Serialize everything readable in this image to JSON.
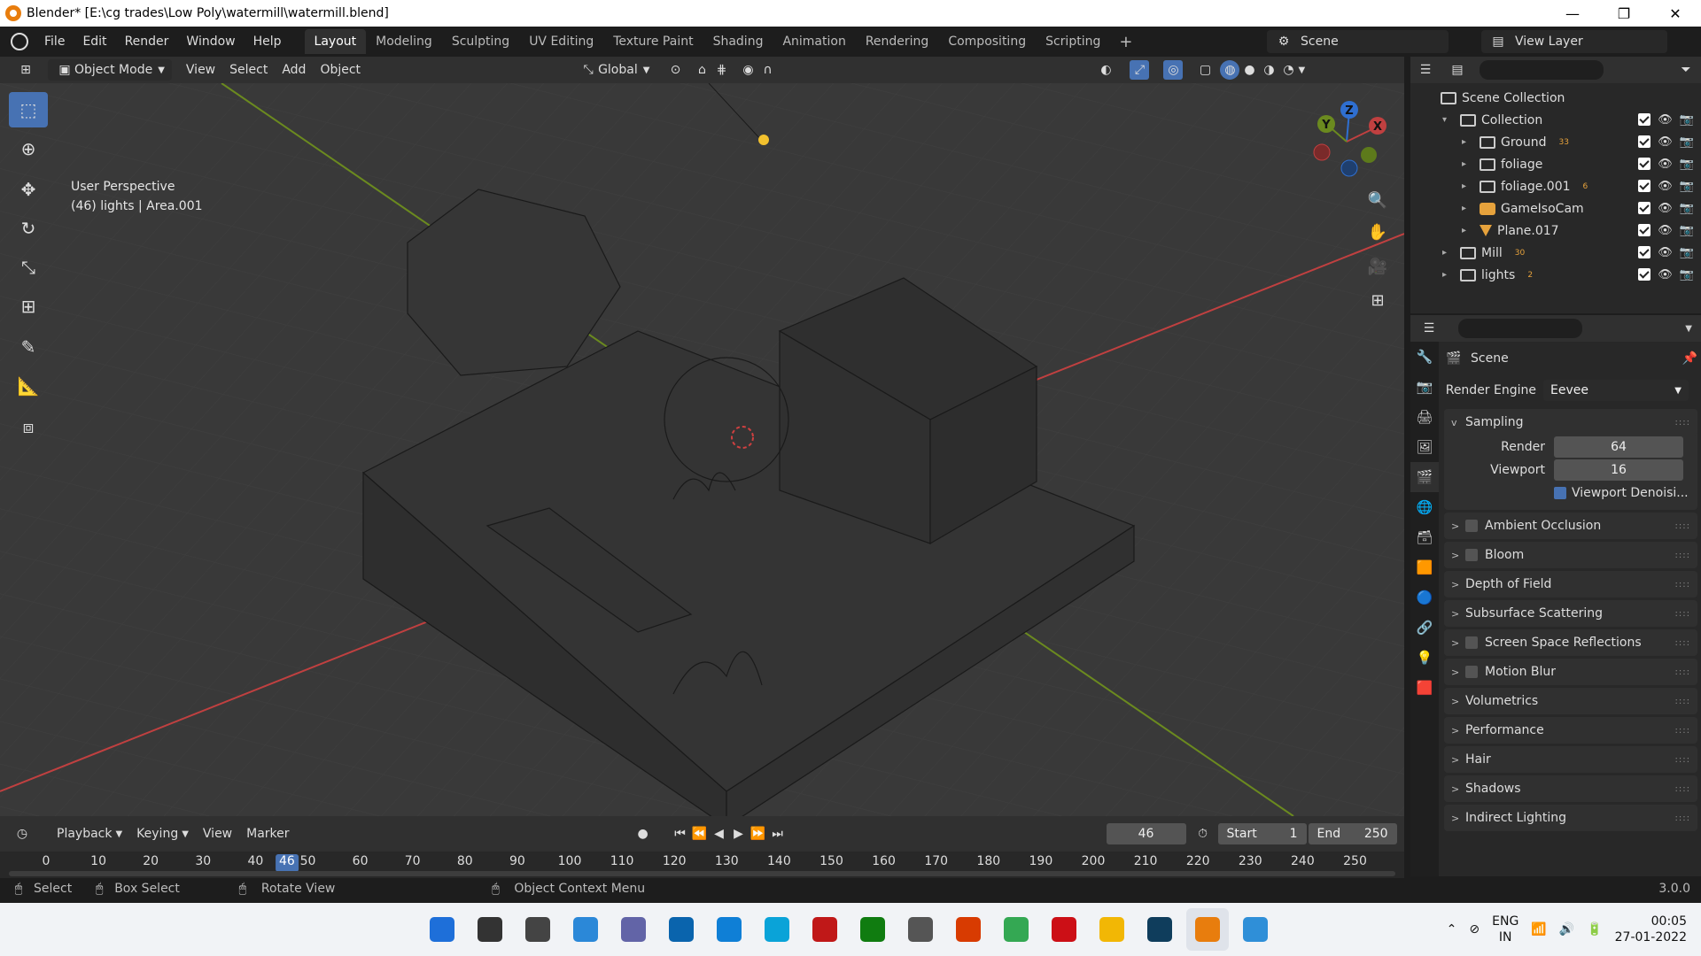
{
  "window": {
    "title": "Blender* [E:\\cg trades\\Low Poly\\watermill\\watermill.blend]",
    "minimize": "—",
    "restore": "❐",
    "close": "✕"
  },
  "menu": {
    "items": [
      "File",
      "Edit",
      "Render",
      "Window",
      "Help"
    ],
    "workspaces": [
      "Layout",
      "Modeling",
      "Sculpting",
      "UV Editing",
      "Texture Paint",
      "Shading",
      "Animation",
      "Rendering",
      "Compositing",
      "Scripting"
    ],
    "active_workspace": "Layout",
    "add_workspace": "+",
    "scene": "Scene",
    "view_layer": "View Layer"
  },
  "viewport_header": {
    "mode": "Object Mode",
    "menus": [
      "View",
      "Select",
      "Add",
      "Object"
    ],
    "transform_orientation": "Global"
  },
  "viewport": {
    "perspective_label": "User Perspective",
    "info_label": "(46) lights | Area.001",
    "axis_labels": {
      "x": "X",
      "y": "Y",
      "z": "Z"
    }
  },
  "tools": [
    "select-box",
    "cursor",
    "move",
    "rotate",
    "scale",
    "transform",
    "annotate",
    "measure",
    "add-cube"
  ],
  "outliner": {
    "root": "Scene Collection",
    "items": [
      {
        "name": "Collection",
        "indent": 1,
        "type": "collection",
        "badge": ""
      },
      {
        "name": "Ground",
        "indent": 2,
        "type": "collection",
        "badge": "33"
      },
      {
        "name": "foliage",
        "indent": 2,
        "type": "collection",
        "badge": ""
      },
      {
        "name": "foliage.001",
        "indent": 2,
        "type": "collection",
        "badge": "6"
      },
      {
        "name": "GameIsoCam",
        "indent": 2,
        "type": "camera",
        "badge": ""
      },
      {
        "name": "Plane.017",
        "indent": 2,
        "type": "mesh",
        "badge": ""
      },
      {
        "name": "Mill",
        "indent": 1,
        "type": "collection",
        "badge": "30"
      },
      {
        "name": "lights",
        "indent": 1,
        "type": "collection",
        "badge": "2"
      }
    ]
  },
  "properties": {
    "context": "Scene",
    "render_engine_label": "Render Engine",
    "render_engine": "Eevee",
    "sampling": {
      "title": "Sampling",
      "render_label": "Render",
      "render": "64",
      "viewport_label": "Viewport",
      "viewport": "16",
      "denoise_label": "Viewport Denoisi..."
    },
    "panels": [
      {
        "label": "Ambient Occlusion",
        "checkbox": true
      },
      {
        "label": "Bloom",
        "checkbox": true
      },
      {
        "label": "Depth of Field",
        "checkbox": false
      },
      {
        "label": "Subsurface Scattering",
        "checkbox": false
      },
      {
        "label": "Screen Space Reflections",
        "checkbox": true
      },
      {
        "label": "Motion Blur",
        "checkbox": true
      },
      {
        "label": "Volumetrics",
        "checkbox": false
      },
      {
        "label": "Performance",
        "checkbox": false
      },
      {
        "label": "Hair",
        "checkbox": false
      },
      {
        "label": "Shadows",
        "checkbox": false
      },
      {
        "label": "Indirect Lighting",
        "checkbox": false
      }
    ]
  },
  "timeline": {
    "menus": [
      "Playback",
      "Keying",
      "View",
      "Marker"
    ],
    "current_frame": "46",
    "start_label": "Start",
    "start": "1",
    "end_label": "End",
    "end": "250",
    "ticks": [
      "0",
      "10",
      "20",
      "30",
      "40",
      "50",
      "60",
      "70",
      "80",
      "90",
      "100",
      "110",
      "120",
      "130",
      "140",
      "150",
      "160",
      "170",
      "180",
      "190",
      "200",
      "210",
      "220",
      "230",
      "240",
      "250"
    ],
    "playhead_label": "46"
  },
  "statusbar": {
    "select": "Select",
    "box_select": "Box Select",
    "rotate_view": "Rotate View",
    "context_menu": "Object Context Menu",
    "version": "3.0.0"
  },
  "taskbar": {
    "apps": [
      "start",
      "search",
      "task-view",
      "widgets",
      "teams",
      "mail",
      "edge",
      "launcher",
      "mcafee",
      "xbox",
      "settings",
      "office",
      "chrome",
      "opera",
      "explorer",
      "photoshop",
      "blender",
      "store"
    ],
    "lang": "ENG",
    "region": "IN",
    "time": "00:05",
    "date": "27-01-2022"
  },
  "colors": {
    "accent_blue": "#4772b3",
    "axis_x": "#c04040",
    "axis_y": "#6b8a1f",
    "axis_z": "#2f6fd0",
    "blender_orange": "#e87d0d"
  }
}
